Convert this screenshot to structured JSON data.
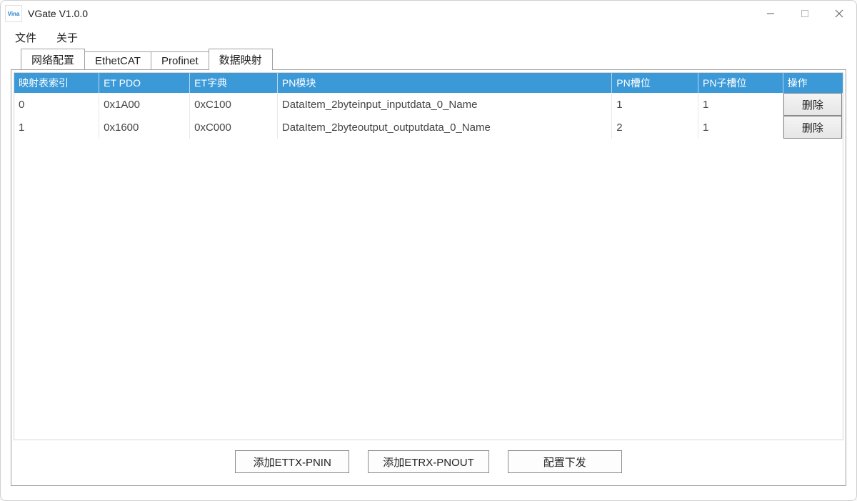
{
  "window": {
    "title": "VGate V1.0.0",
    "icon_label": "Vina"
  },
  "menu": {
    "file": "文件",
    "about": "关于"
  },
  "tabs": {
    "net": "网络配置",
    "ecat": "EthetCAT",
    "profinet": "Profinet",
    "datamap": "数据映射"
  },
  "grid": {
    "headers": {
      "index": "映射表索引",
      "etpdo": "ET PDO",
      "etdict": "ET字典",
      "pnmod": "PN模块",
      "pnslot": "PN槽位",
      "pnsubslot": "PN子槽位",
      "op": "操作"
    },
    "rows": [
      {
        "index": "0",
        "etpdo": "0x1A00",
        "etdict": "0xC100",
        "pnmod": "DataItem_2byteinput_inputdata_0_Name",
        "pnslot": "1",
        "pnsubslot": "1",
        "op": "删除"
      },
      {
        "index": "1",
        "etpdo": "0x1600",
        "etdict": "0xC000",
        "pnmod": "DataItem_2byteoutput_outputdata_0_Name",
        "pnslot": "2",
        "pnsubslot": "1",
        "op": "删除"
      }
    ]
  },
  "buttons": {
    "add_tx": "添加ETTX-PNIN",
    "add_rx": "添加ETRX-PNOUT",
    "download": "配置下发"
  }
}
